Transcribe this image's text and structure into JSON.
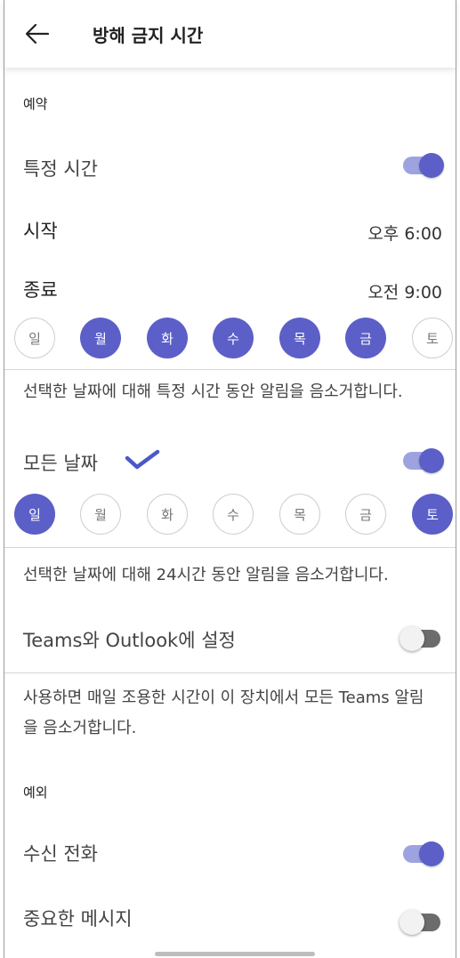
{
  "header": {
    "title": "방해 금지 시간"
  },
  "scheduled": {
    "section_label": "예약",
    "specific_time_label": "특정 시간",
    "specific_time_on": true,
    "start_label": "시작",
    "start_value": "오후 6:00",
    "end_label": "종료",
    "end_value": "오전 9:00",
    "days": [
      {
        "label": "일",
        "selected": false
      },
      {
        "label": "월",
        "selected": true
      },
      {
        "label": "화",
        "selected": true
      },
      {
        "label": "수",
        "selected": true
      },
      {
        "label": "목",
        "selected": true
      },
      {
        "label": "금",
        "selected": true
      },
      {
        "label": "토",
        "selected": false
      }
    ],
    "description": "선택한 날짜에 대해 특정 시간 동안 알림을 음소거합니다."
  },
  "all_day": {
    "label": "모든 날짜",
    "on": true,
    "days": [
      {
        "label": "일",
        "selected": true
      },
      {
        "label": "월",
        "selected": false
      },
      {
        "label": "화",
        "selected": false
      },
      {
        "label": "수",
        "selected": false
      },
      {
        "label": "목",
        "selected": false
      },
      {
        "label": "금",
        "selected": false
      },
      {
        "label": "토",
        "selected": true
      }
    ],
    "description": "선택한 날짜에 대해 24시간 동안 알림을 음소거합니다."
  },
  "sync": {
    "label": "Teams와 Outlook에 설정",
    "on": false,
    "description": "사용하면 매일 조용한 시간이 이 장치에서 모든 Teams 알림을 음소거합니다."
  },
  "exceptions": {
    "section_label": "예외",
    "incoming_calls_label": "수신 전화",
    "incoming_calls_on": true,
    "important_messages_label": "중요한 메시지",
    "important_messages_on": false
  },
  "colors": {
    "accent": "#5b5fc7",
    "accent_track": "#9ea3e0"
  }
}
